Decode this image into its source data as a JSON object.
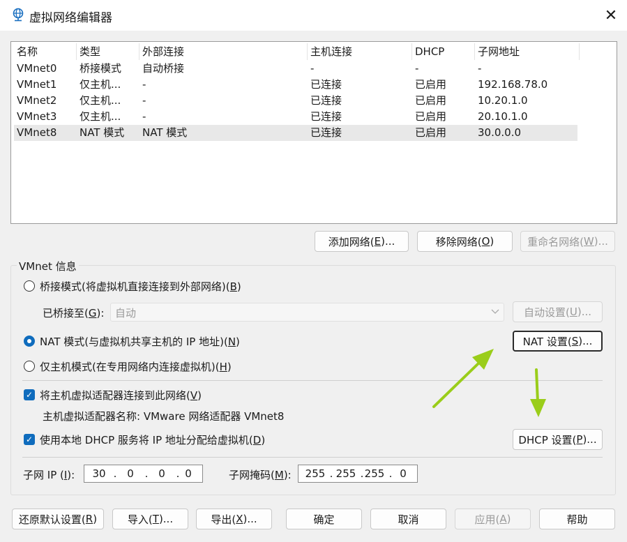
{
  "window": {
    "title": "虚拟网络编辑器",
    "close_glyph": "✕"
  },
  "table": {
    "headers": [
      "名称",
      "类型",
      "外部连接",
      "主机连接",
      "DHCP",
      "子网地址"
    ],
    "rows": [
      [
        "VMnet0",
        "桥接模式",
        "自动桥接",
        "-",
        "-",
        "-"
      ],
      [
        "VMnet1",
        "仅主机...",
        "-",
        "已连接",
        "已启用",
        "192.168.78.0"
      ],
      [
        "VMnet2",
        "仅主机...",
        "-",
        "已连接",
        "已启用",
        "10.20.1.0"
      ],
      [
        "VMnet3",
        "仅主机...",
        "-",
        "已连接",
        "已启用",
        "20.10.1.0"
      ],
      [
        "VMnet8",
        "NAT 模式",
        "NAT 模式",
        "已连接",
        "已启用",
        "30.0.0.0"
      ]
    ],
    "selected_row": "VMnet8"
  },
  "net_buttons": {
    "add": {
      "pre": "添加网络(",
      "key": "E",
      "post": ")..."
    },
    "remove": {
      "pre": "移除网络(",
      "key": "O",
      "post": ")"
    },
    "rename": {
      "pre": "重命名网络(",
      "key": "W",
      "post": ")..."
    }
  },
  "vmnet_info": {
    "group_label": "VMnet 信息",
    "bridge_radio": {
      "pre": "桥接模式(将虚拟机直接连接到外部网络)(",
      "key": "B",
      "post": ")"
    },
    "bridged_to": {
      "pre": "已桥接至(",
      "key": "G",
      "post": "):"
    },
    "bridged_value": "自动",
    "auto_settings": {
      "pre": "自动设置(",
      "key": "U",
      "post": ")..."
    },
    "nat_radio": {
      "pre": "NAT 模式(与虚拟机共享主机的 IP 地址)(",
      "key": "N",
      "post": ")"
    },
    "nat_settings": {
      "pre": "NAT 设置(",
      "key": "S",
      "post": ")..."
    },
    "host_only_radio": {
      "pre": "仅主机模式(在专用网络内连接虚拟机)(",
      "key": "H",
      "post": ")"
    },
    "connect_adapter": {
      "pre": "将主机虚拟适配器连接到此网络(",
      "key": "V",
      "post": ")"
    },
    "adapter_name": "主机虚拟适配器名称: VMware 网络适配器 VMnet8",
    "use_dhcp": {
      "pre": "使用本地 DHCP 服务将 IP 地址分配给虚拟机(",
      "key": "D",
      "post": ")"
    },
    "dhcp_settings": {
      "pre": "DHCP 设置(",
      "key": "P",
      "post": ")..."
    },
    "subnet_ip_label": {
      "pre": "子网 IP (",
      "key": "I",
      "post": "):"
    },
    "subnet_ip": [
      "30",
      "0",
      "0",
      "0"
    ],
    "subnet_mask_label": {
      "pre": "子网掩码(",
      "key": "M",
      "post": "):"
    },
    "subnet_mask": [
      "255",
      "255",
      "255",
      "0"
    ],
    "selected_mode": "NAT"
  },
  "footer": {
    "restore": {
      "pre": "还原默认设置(",
      "key": "R",
      "post": ")"
    },
    "import": {
      "pre": "导入(",
      "key": "T",
      "post": ")..."
    },
    "export": {
      "pre": "导出(",
      "key": "X",
      "post": ")..."
    },
    "ok": "确定",
    "cancel": "取消",
    "apply": {
      "pre": "应用(",
      "key": "A",
      "post": ")"
    },
    "help": "帮助"
  },
  "colors": {
    "accent": "#0f6cbd",
    "arrow": "#9acd1a"
  }
}
